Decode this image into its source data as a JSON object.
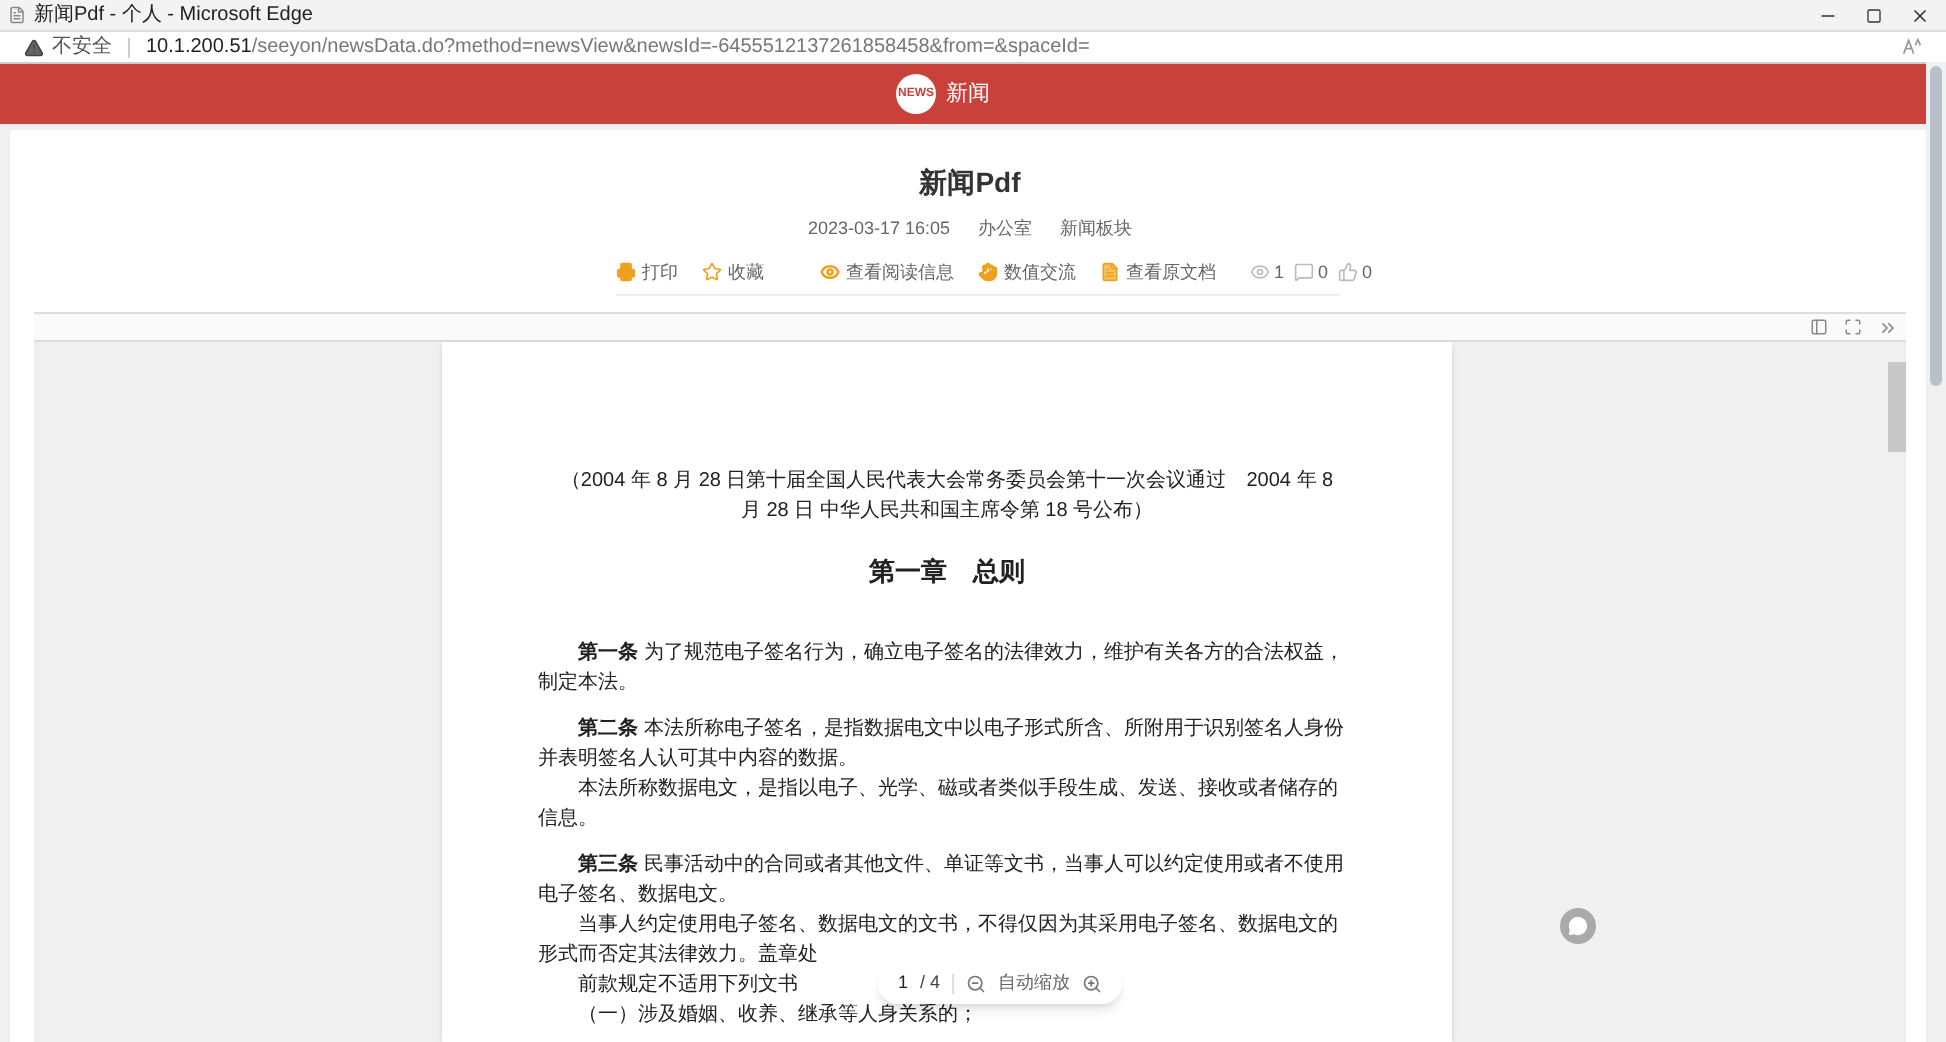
{
  "browser": {
    "tab_title": "新闻Pdf - 个人 - Microsoft Edge",
    "security": "不安全",
    "url_host": "10.1.200.51",
    "url_path": "/seeyon/newsData.do?method=newsView&newsId=-6455512137261858458&from=&spaceId="
  },
  "header": {
    "logo": "NEWS",
    "title": "新闻"
  },
  "article": {
    "title": "新闻Pdf",
    "date": "2023-03-17 16:05",
    "department": "办公室",
    "board": "新闻板块",
    "actions": [
      {
        "kind": "print",
        "label": "打印"
      },
      {
        "kind": "star",
        "label": "收藏"
      },
      {
        "kind": "eye",
        "label": "查看阅读信息"
      },
      {
        "kind": "hand",
        "label": "数值交流"
      },
      {
        "kind": "doc",
        "label": "查看原文档"
      }
    ],
    "stats": [
      {
        "kind": "eye",
        "value": "1"
      },
      {
        "kind": "comment",
        "value": "0"
      },
      {
        "kind": "like",
        "value": "0"
      }
    ]
  },
  "document": {
    "blocks": [
      {
        "kind": "subtitle",
        "text": "（2004 年 8 月 28 日第十届全国人民代表大会常务委员会第十一次会议通过　2004 年 8 月 28 日  中华人民共和国主席令第 18 号公布）"
      },
      {
        "kind": "heading",
        "text": "第一章　总则"
      },
      {
        "kind": "article",
        "text": "**第一条** 为了规范电子签名行为，确立电子签名的法律效力，维护有关各方的合法权益，制定本法。"
      },
      {
        "kind": "article",
        "text": "**第二条** 本法所称电子签名，是指数据电文中以电子形式所含、所附用于识别签名人身份并表明签名人认可其中内容的数据。"
      },
      {
        "kind": "para",
        "text": "本法所称数据电文，是指以电子、光学、磁或者类似手段生成、发送、接收或者储存的信息。"
      },
      {
        "kind": "article",
        "text": "**第三条** 民事活动中的合同或者其他文件、单证等文书，当事人可以约定使用或者不使用电子签名、数据电文。"
      },
      {
        "kind": "para",
        "text": "当事人约定使用电子签名、数据电文的文书，不得仅因为其采用电子签名、数据电文的形式而否定其法律效力。盖章处"
      },
      {
        "kind": "para",
        "text": "前款规定不适用下列文书"
      },
      {
        "kind": "para",
        "text": "（一）涉及婚姻、收养、继承等人身关系的；"
      }
    ],
    "page": "1",
    "pages": "/ 4",
    "zoom": "自动缩放"
  }
}
